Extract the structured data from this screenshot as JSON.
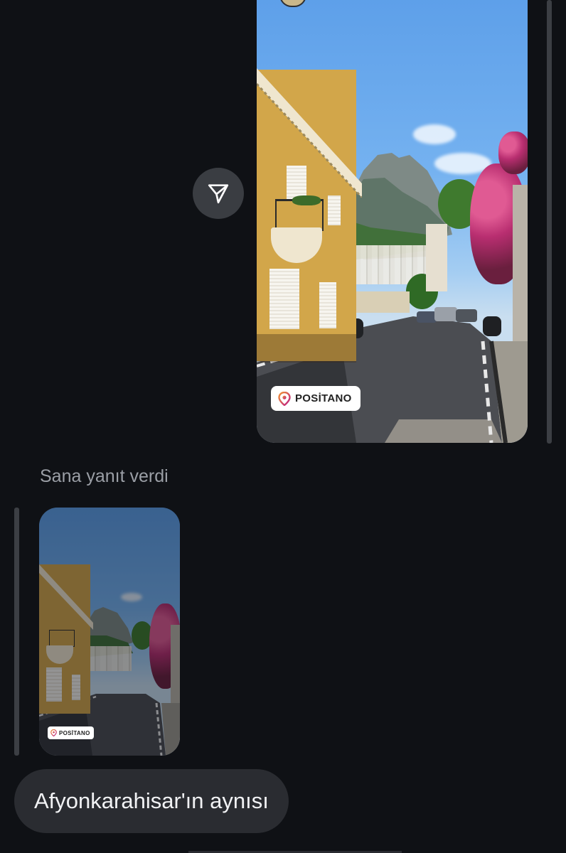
{
  "story_main": {
    "location_tag": "POSİTANO"
  },
  "story_thumbnail": {
    "location_tag": "POSİTANO"
  },
  "replied_label": "Sana yanıt verdi",
  "message": {
    "text": "Afyonkarahisar'ın aynısı"
  },
  "icons": {
    "share": "send-paper-plane-icon",
    "location": "location-pin-icon"
  },
  "colors": {
    "background": "#0f1115",
    "bubble": "#2a2c31",
    "share_button": "#3a3d42",
    "secondary_text": "#9b9fa6",
    "pin_gradient_start": "#f09433",
    "pin_gradient_end": "#bc1888"
  }
}
